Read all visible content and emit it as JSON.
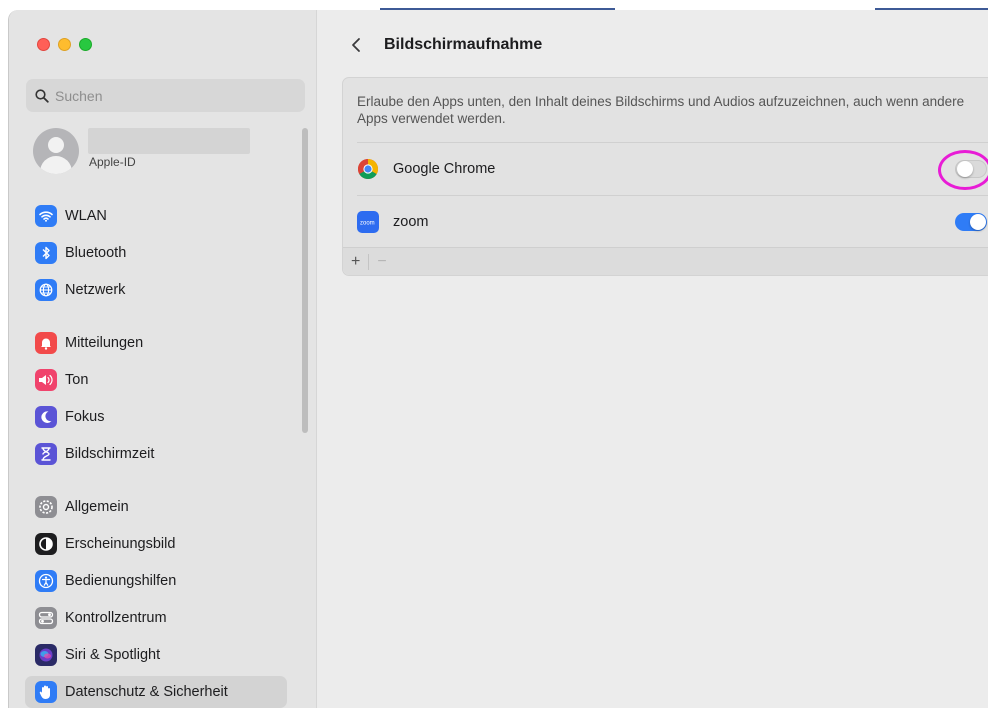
{
  "window": {
    "title": "Bildschirmaufnahme"
  },
  "sidebar": {
    "search_placeholder": "Suchen",
    "account": {
      "subtitle": "Apple-ID"
    },
    "items": [
      {
        "label": "WLAN",
        "icon": "wifi-icon",
        "color": "#2f7cf6"
      },
      {
        "label": "Bluetooth",
        "icon": "bluetooth-icon",
        "color": "#2f7cf6"
      },
      {
        "label": "Netzwerk",
        "icon": "globe-icon",
        "color": "#2f7cf6"
      },
      {
        "label": "Mitteilungen",
        "icon": "bell-icon",
        "color": "#f24a4a"
      },
      {
        "label": "Ton",
        "icon": "speaker-icon",
        "color": "#f0436c"
      },
      {
        "label": "Fokus",
        "icon": "moon-icon",
        "color": "#5b54d6"
      },
      {
        "label": "Bildschirmzeit",
        "icon": "hourglass-icon",
        "color": "#5b54d6"
      },
      {
        "label": "Allgemein",
        "icon": "gear-icon",
        "color": "#8e8e93"
      },
      {
        "label": "Erscheinungsbild",
        "icon": "appearance-icon",
        "color": "#1d1d1f"
      },
      {
        "label": "Bedienungshilfen",
        "icon": "accessibility-icon",
        "color": "#2f7cf6"
      },
      {
        "label": "Kontrollzentrum",
        "icon": "control-center-icon",
        "color": "#8e8e93"
      },
      {
        "label": "Siri & Spotlight",
        "icon": "siri-icon",
        "color": "#3a3a8c"
      },
      {
        "label": "Datenschutz & Sicherheit",
        "icon": "hand-icon",
        "color": "#2f7cf6",
        "active": true
      }
    ]
  },
  "main": {
    "title": "Bildschirmaufnahme",
    "description": "Erlaube den Apps unten, den Inhalt deines Bildschirms und Audios aufzuzeichnen, auch wenn andere Apps verwendet werden.",
    "apps": [
      {
        "name": "Google Chrome",
        "icon": "chrome-icon",
        "enabled": false
      },
      {
        "name": "zoom",
        "icon": "zoom-icon",
        "enabled": true
      }
    ],
    "footer": {
      "add": "+",
      "remove": "−"
    }
  }
}
